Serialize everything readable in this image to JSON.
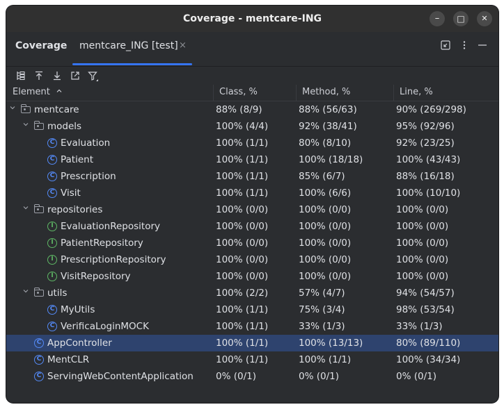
{
  "window": {
    "title": "Coverage - mentcare-ING"
  },
  "window_controls": {
    "minimize": "–",
    "maximize": "□",
    "close": "✕"
  },
  "tabs": {
    "tool_name": "Coverage",
    "run_tab": "mentcare_ING [test]",
    "close_glyph": "×"
  },
  "tabbar_right": [
    "restore-layout-icon",
    "more-options-icon",
    "hide-panel-icon"
  ],
  "toolbar": [
    "flatten-packages-icon",
    "collapse-all-icon",
    "expand-all-icon",
    "navigate-to-source-icon",
    "filter-icon"
  ],
  "columns": {
    "element": "Element",
    "class": "Class, %",
    "method": "Method, %",
    "line": "Line, %"
  },
  "colors": {
    "accent": "#3574f0",
    "selection": "#2e436e",
    "class_icon": "#548af7",
    "interface_icon": "#5fb865"
  },
  "rows": [
    {
      "name": "mentcare",
      "kind": "package",
      "level": 0,
      "expanded": true,
      "class": "88% (8/9)",
      "method": "88% (56/63)",
      "line": "90% (269/298)"
    },
    {
      "name": "models",
      "kind": "package",
      "level": 1,
      "expanded": true,
      "class": "100% (4/4)",
      "method": "92% (38/41)",
      "line": "95% (92/96)"
    },
    {
      "name": "Evaluation",
      "kind": "class",
      "level": 2,
      "class": "100% (1/1)",
      "method": "80% (8/10)",
      "line": "92% (23/25)"
    },
    {
      "name": "Patient",
      "kind": "class",
      "level": 2,
      "class": "100% (1/1)",
      "method": "100% (18/18)",
      "line": "100% (43/43)"
    },
    {
      "name": "Prescription",
      "kind": "class",
      "level": 2,
      "class": "100% (1/1)",
      "method": "85% (6/7)",
      "line": "88% (16/18)"
    },
    {
      "name": "Visit",
      "kind": "class",
      "level": 2,
      "class": "100% (1/1)",
      "method": "100% (6/6)",
      "line": "100% (10/10)"
    },
    {
      "name": "repositories",
      "kind": "package",
      "level": 1,
      "expanded": true,
      "class": "100% (0/0)",
      "method": "100% (0/0)",
      "line": "100% (0/0)"
    },
    {
      "name": "EvaluationRepository",
      "kind": "interface",
      "level": 2,
      "class": "100% (0/0)",
      "method": "100% (0/0)",
      "line": "100% (0/0)"
    },
    {
      "name": "PatientRepository",
      "kind": "interface",
      "level": 2,
      "class": "100% (0/0)",
      "method": "100% (0/0)",
      "line": "100% (0/0)"
    },
    {
      "name": "PrescriptionRepository",
      "kind": "interface",
      "level": 2,
      "class": "100% (0/0)",
      "method": "100% (0/0)",
      "line": "100% (0/0)"
    },
    {
      "name": "VisitRepository",
      "kind": "interface",
      "level": 2,
      "class": "100% (0/0)",
      "method": "100% (0/0)",
      "line": "100% (0/0)"
    },
    {
      "name": "utils",
      "kind": "package",
      "level": 1,
      "expanded": true,
      "class": "100% (2/2)",
      "method": "57% (4/7)",
      "line": "94% (54/57)"
    },
    {
      "name": "MyUtils",
      "kind": "class",
      "level": 2,
      "class": "100% (1/1)",
      "method": "75% (3/4)",
      "line": "98% (53/54)"
    },
    {
      "name": "VerificaLoginMOCK",
      "kind": "class",
      "level": 2,
      "class": "100% (1/1)",
      "method": "33% (1/3)",
      "line": "33% (1/3)"
    },
    {
      "name": "AppController",
      "kind": "class",
      "level": 1,
      "selected": true,
      "class": "100% (1/1)",
      "method": "100% (13/13)",
      "line": "80% (89/110)"
    },
    {
      "name": "MentCLR",
      "kind": "class",
      "level": 1,
      "class": "100% (1/1)",
      "method": "100% (1/1)",
      "line": "100% (34/34)"
    },
    {
      "name": "ServingWebContentApplication",
      "kind": "class",
      "level": 1,
      "class": "0% (0/1)",
      "method": "0% (0/1)",
      "line": "0% (0/1)"
    }
  ]
}
